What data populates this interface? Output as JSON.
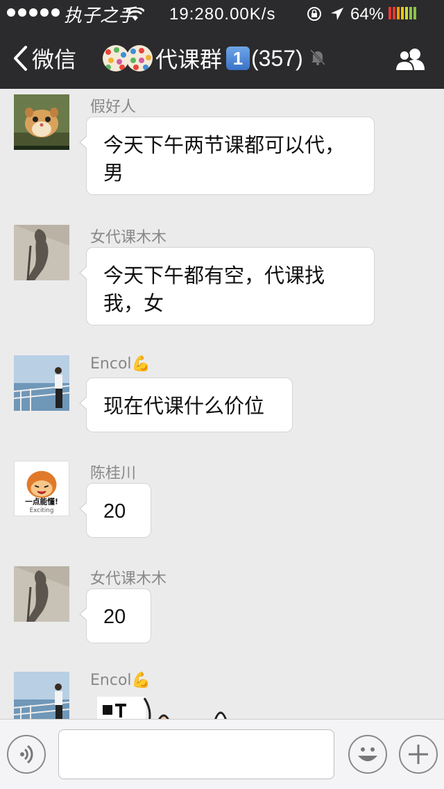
{
  "status_bar": {
    "carrier": "执子之手",
    "time": "19:28",
    "net_speed": "0.00K/s",
    "battery_percent": "64%",
    "battery_colors": [
      "#e53935",
      "#e53935",
      "#ff9800",
      "#ffc107",
      "#cddc39",
      "#8bc34a",
      "#8bc34a"
    ]
  },
  "nav": {
    "back_label": "微信",
    "group_title": "代课群",
    "badge": "1",
    "member_count": "(357)",
    "back_icon": "chevron-left-icon",
    "mute_icon": "bell-muted-icon",
    "members_icon": "group-members-icon"
  },
  "messages": [
    {
      "sender": "假好人",
      "text": "今天下午两节课都可以代，男",
      "avatar": "hamster"
    },
    {
      "sender": "女代课木木",
      "text": "今天下午都有空，代课找我，女",
      "avatar": "shadow"
    },
    {
      "sender": "Encol",
      "sender_emoji": "💪",
      "text": "现在代课什么价位",
      "avatar": "sea"
    },
    {
      "sender": "陈桂川",
      "text": "20",
      "avatar": "cartoon"
    },
    {
      "sender": "女代课木木",
      "text": "20",
      "avatar": "shadow"
    },
    {
      "sender": "Encol",
      "sender_emoji": "💪",
      "text": "",
      "avatar": "sea"
    }
  ],
  "cartoon_avatar_text": [
    "一点能懂!",
    "Exciting"
  ],
  "input_bar": {
    "voice_icon": "voice-icon",
    "emoji_icon": "smiley-icon",
    "add_icon": "plus-icon",
    "value": ""
  }
}
